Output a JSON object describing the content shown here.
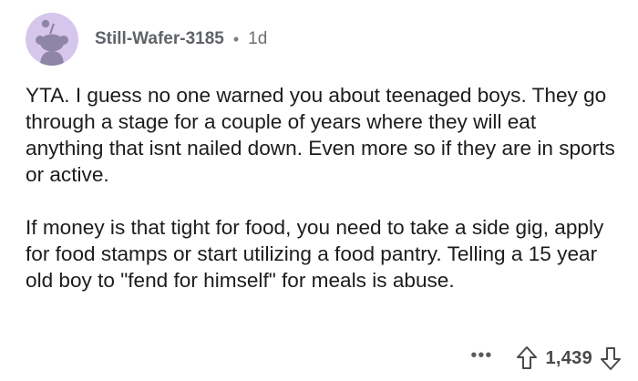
{
  "comment": {
    "author": "Still-Wafer-3185",
    "separator": "•",
    "age": "1d",
    "paragraphs": [
      "YTA. I guess no one warned you about teenaged boys. They go through a stage for a couple of years where they will eat anything that isnt nailed down. Even more so if they are in sports or active.",
      "If money is that tight for food, you need to take a side gig, apply for food stamps or start utilizing a food pantry. Telling a 15 year old boy to \"fend for himself\" for meals is abuse."
    ],
    "actions": {
      "more_label": "•••",
      "score": "1,439"
    }
  },
  "icons": {
    "avatar": "snoo-avatar-icon",
    "more": "more-options-icon",
    "upvote": "upvote-arrow-icon",
    "downvote": "downvote-arrow-icon"
  },
  "colors": {
    "avatar_bg": "#d6c6ec",
    "text": "#1c1c1d",
    "meta": "#606266"
  }
}
